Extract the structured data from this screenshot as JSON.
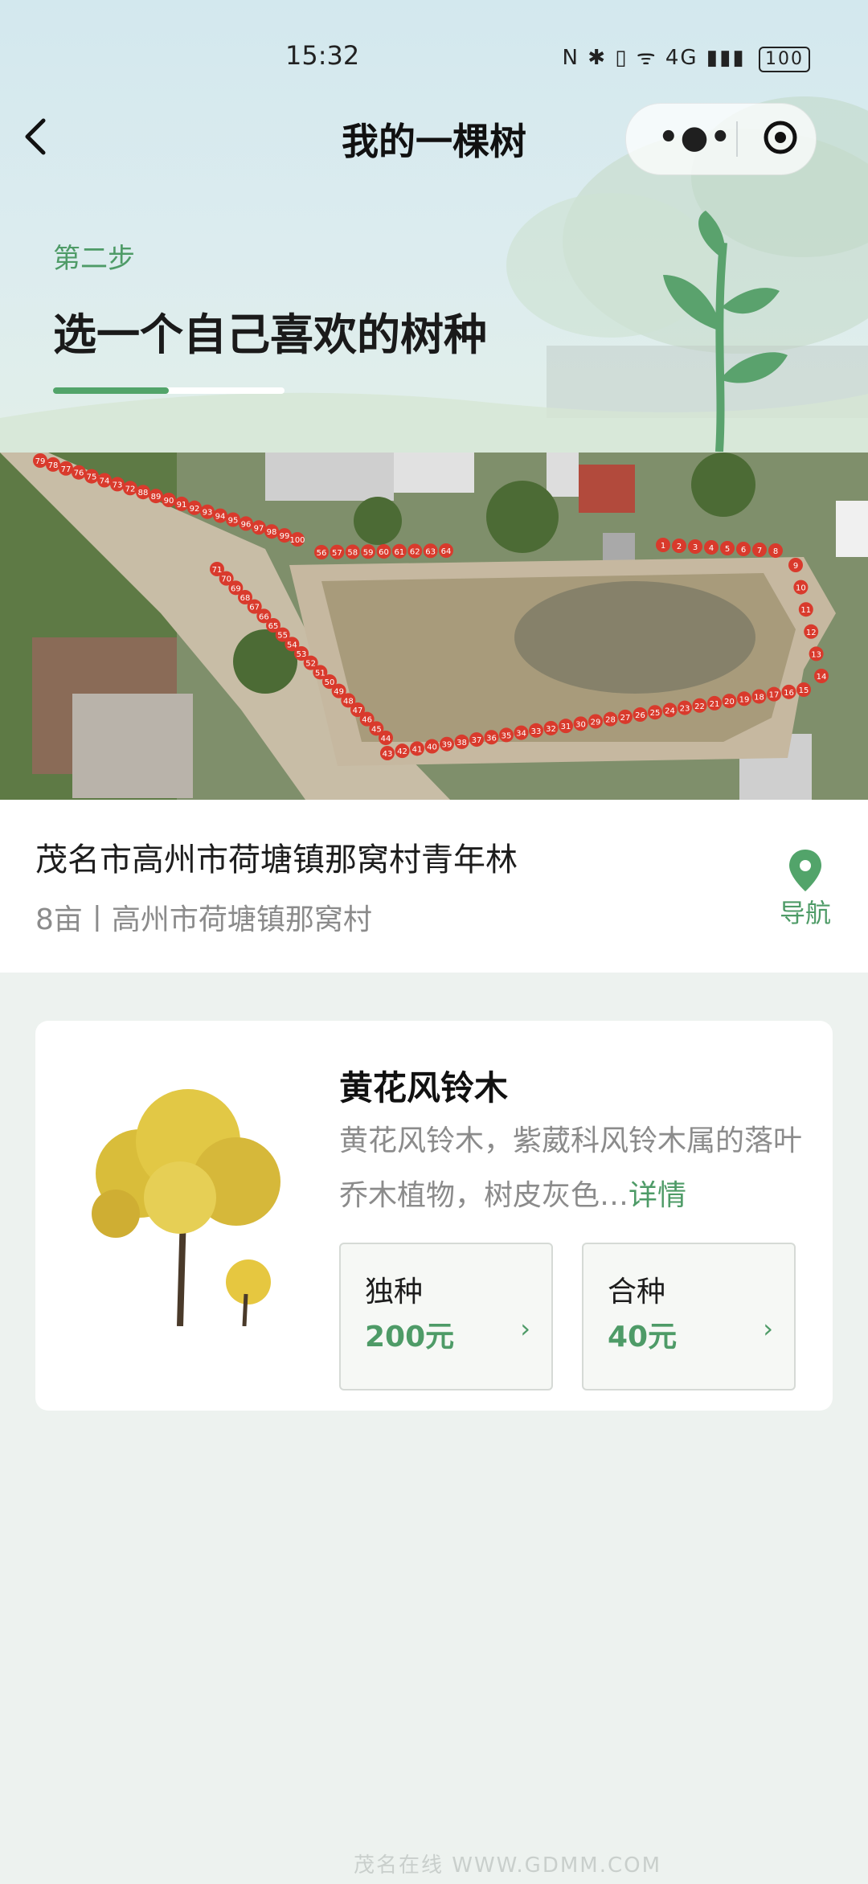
{
  "status_bar": {
    "time": "15:32",
    "network_icons": "N ✱ ▯ ᯤ 4G ▮▮▮",
    "battery": "100"
  },
  "nav": {
    "title": "我的一棵树"
  },
  "step": {
    "label": "第二步",
    "title": "选一个自己喜欢的树种",
    "progress": 0.5
  },
  "map": {
    "plot_numbers_top": [
      "79",
      "78",
      "77",
      "76",
      "75",
      "74",
      "73",
      "72",
      "88",
      "89",
      "90",
      "91",
      "92",
      "93",
      "94",
      "95",
      "96",
      "97",
      "98",
      "99",
      "100"
    ],
    "plot_numbers_pond_top": [
      "56",
      "57",
      "58",
      "59",
      "60",
      "61",
      "62",
      "63",
      "64"
    ],
    "plot_numbers_right_top": [
      "1",
      "2",
      "3",
      "4",
      "5",
      "6",
      "7",
      "8"
    ],
    "plot_numbers_right": [
      "9",
      "10",
      "11",
      "12",
      "13",
      "14"
    ],
    "plot_numbers_left": [
      "71",
      "70",
      "69",
      "68",
      "67",
      "66",
      "65",
      "55",
      "54",
      "53",
      "52",
      "51",
      "50",
      "49",
      "48",
      "47",
      "46",
      "45",
      "44"
    ],
    "plot_numbers_bottom": [
      "43",
      "42",
      "41",
      "40",
      "39",
      "38",
      "37",
      "36",
      "35",
      "34",
      "33",
      "32",
      "31",
      "30",
      "29",
      "28",
      "27",
      "26",
      "25",
      "24",
      "23",
      "22",
      "21",
      "20",
      "19",
      "18",
      "17",
      "16",
      "15"
    ]
  },
  "location": {
    "name": "茂名市高州市荷塘镇那窝村青年林",
    "sub": "8亩丨高州市荷塘镇那窝村",
    "nav_label": "导航"
  },
  "tree": {
    "name": "黄花风铃木",
    "desc": "黄花风铃木，紫葳科风铃木属的落叶乔木植物，树皮灰色…",
    "detail_label": "详情",
    "options": [
      {
        "label": "独种",
        "price": "200元"
      },
      {
        "label": "合种",
        "price": "40元"
      }
    ]
  },
  "watermark": "茂名在线 WWW.GDMM.COM"
}
